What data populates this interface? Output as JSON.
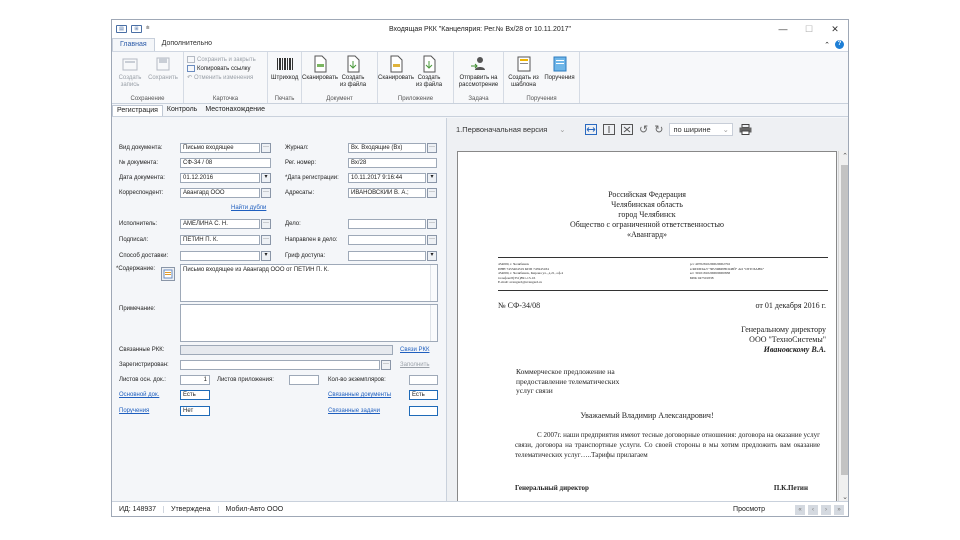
{
  "window": {
    "title": "Входящая РКК \"Канцелярия: Рег.№ Вх/28 от 10.11.2017\"",
    "controls": [
      "—",
      "☐",
      "✕"
    ]
  },
  "ribbon_tabs": [
    "Главная",
    "Дополнительно"
  ],
  "ribbon": {
    "save_group": {
      "label": "Сохранение",
      "create": "Создать запись",
      "save": "Сохранить"
    },
    "card_group": {
      "label": "Карточка",
      "save_close": "Сохранить и закрыть",
      "copy_link": "Копировать ссылку",
      "undo": "Отменить изменения"
    },
    "print_group": {
      "label": "Печать",
      "barcode": "Штрихкод"
    },
    "doc_group": {
      "label": "Документ",
      "scan": "Сканировать",
      "create_file": "Создать из файла"
    },
    "attach_group": {
      "label": "Приложение",
      "scan": "Сканировать",
      "create_file": "Создать из файла"
    },
    "task_group": {
      "label": "Задача",
      "send": "Отправить на рассмотрение"
    },
    "orders_group": {
      "label": "Поручения",
      "create_template": "Создать из шаблона",
      "orders": "Поручения"
    }
  },
  "form_tabs": [
    "Регистрация",
    "Контроль",
    "Местонахождение"
  ],
  "form": {
    "doc_type": {
      "label": "Вид документа:",
      "value": "Письмо входящее"
    },
    "journal": {
      "label": "Журнал:",
      "value": "Вх. Входящие (Вх)"
    },
    "doc_no": {
      "label": "№ документа:",
      "value": "СФ-34 / 08"
    },
    "reg_no": {
      "label": "Рег. номер:",
      "value": "Вх/28"
    },
    "doc_date": {
      "label": "Дата документа:",
      "value": "01.12.2016"
    },
    "reg_date": {
      "label": "*Дата регистрации:",
      "value": "10.11.2017 9:16:44"
    },
    "correspondent": {
      "label": "Корреспондент:",
      "value": "Авангард ООО"
    },
    "addressee": {
      "label": "Адресаты:",
      "value": "ИВАНОВСКИЙ В. А.;"
    },
    "find_dupes": "Найти дубли",
    "executor": {
      "label": "Исполнитель:",
      "value": "АМЕЛИНА С. Н."
    },
    "case": {
      "label": "Дело:",
      "value": ""
    },
    "signed": {
      "label": "Подписал:",
      "value": "ПЕТИН П. К."
    },
    "sent_to": {
      "label": "Направлен в дело:",
      "value": ""
    },
    "delivery": {
      "label": "Способ доставки:",
      "value": ""
    },
    "access": {
      "label": "Гриф доступа:",
      "value": ""
    },
    "content": {
      "label": "*Содержание:",
      "value": "Письмо входящее из Авангард ООО от ПЕТИН П. К."
    },
    "note": {
      "label": "Примечание:",
      "value": ""
    },
    "linked": {
      "label": "Связанные РКК:",
      "link": "Связи РКК"
    },
    "registered": {
      "label": "Зарегистрирован:",
      "link": "Заполнить"
    },
    "sheets": {
      "label": "Листов осн. док.:",
      "value": "1"
    },
    "att_sheets": {
      "label": "Листов приложения:",
      "value": ""
    },
    "copies": {
      "label": "Кол-во экземпляров:",
      "value": ""
    },
    "main_doc": {
      "label": "Основной док.",
      "value": "Есть"
    },
    "linked_docs": {
      "label": "Связанные документы",
      "value": "Есть"
    },
    "orders": {
      "label": "Поручения",
      "value": "Нет"
    },
    "linked_tasks": {
      "label": "Связанные задачи",
      "value": ""
    }
  },
  "viewer": {
    "version": "1.Первоначальная версия",
    "zoom": "по ширине"
  },
  "letter": {
    "header": [
      "Российская Федерация",
      "Челябинская область",
      "город Челябинск",
      "Общество с ограниченной ответственностью",
      "«Авангард»"
    ],
    "req_left": [
      "454000, г. Челябинск",
      "ИНН 7453404319 КПП 745945184",
      "454000, г. Челябинск, Кирова ул., д.21, оф.4",
      "телефон:8(351)891-13-16",
      "E-mail: avangard@avangard.ru"
    ],
    "req_right": [
      "р/с 40702810290020002702",
      "в ФИЛИАЛ \"ЧЕЛЯБИНСКИЙ\" АО \"ОТП БАНК\"",
      "к/с 30101810200000000838",
      "БИК 047501838"
    ],
    "number": "№ СФ-34/08",
    "date": "от 01 декабря 2016 г.",
    "to1": "Генеральному директору",
    "to2": "ООО \"ТехноСистемы\"",
    "to3": "Ивановскому В.А.",
    "subject": [
      "Коммерческое предложение на",
      "предоставление телематических",
      "услуг связи"
    ],
    "greeting": "Уважаемый Владимир Александрович!",
    "body": "С 2007г. наши предприятия имеют тесные договорные отношения: договора на оказание услуг связи, договора на транспортные услуги. Со своей стороны в мы хотим предложить вам оказание телематических услуг…..Тарифы прилагаем",
    "sign_title": "Генеральный директор",
    "sign_name": "П.К.Петин"
  },
  "status": {
    "id": "ИД: 148937",
    "state": "Утверждена",
    "company": "Мобил-Авто ООО",
    "mode": "Просмотр"
  }
}
